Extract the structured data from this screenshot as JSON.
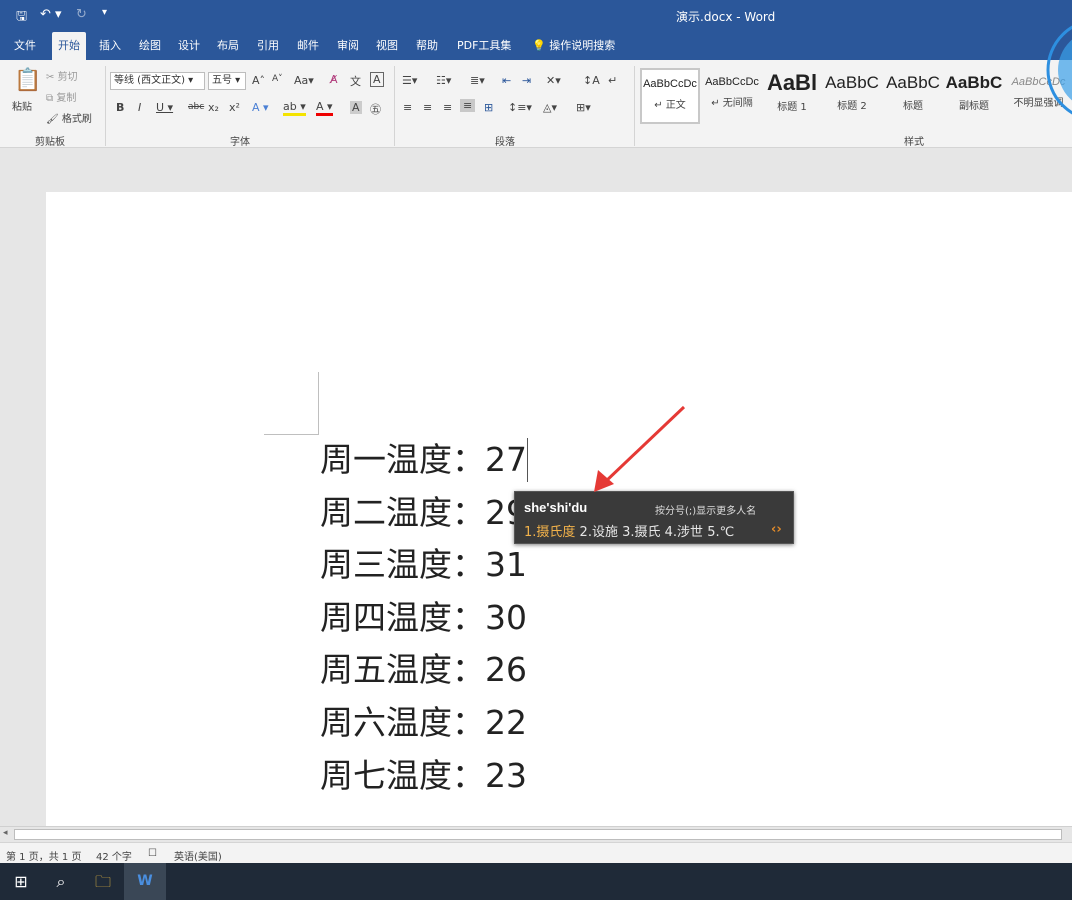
{
  "titlebar": {
    "title": "演示.docx  -  Word",
    "save_icon": "save-icon",
    "undo_icon": "undo-icon",
    "redo_icon": "redo-icon"
  },
  "menu": {
    "tabs": [
      "文件",
      "开始",
      "插入",
      "绘图",
      "设计",
      "布局",
      "引用",
      "邮件",
      "审阅",
      "视图",
      "帮助",
      "PDF工具集",
      "操作说明搜索"
    ],
    "active": "开始"
  },
  "ribbon": {
    "clipboard": {
      "paste": "粘贴",
      "cut": "剪切",
      "copy": "复制",
      "format_painter": "格式刷",
      "label": "剪贴板"
    },
    "font": {
      "family": "等线 (西文正文)",
      "size": "五号",
      "label": "字体"
    },
    "paragraph": {
      "label": "段落"
    },
    "styles": {
      "label": "样式",
      "items": [
        {
          "preview": "AaBbCcDc",
          "name": "↵ 正文"
        },
        {
          "preview": "AaBbCcDc",
          "name": "↵ 无间隔"
        },
        {
          "preview": "AaBl",
          "name": "标题 1"
        },
        {
          "preview": "AaBbC",
          "name": "标题 2"
        },
        {
          "preview": "AaBbC",
          "name": "标题"
        },
        {
          "preview": "AaBbC",
          "name": "副标题"
        },
        {
          "preview": "AaBbCcDc",
          "name": "不明显强调"
        }
      ]
    }
  },
  "document": {
    "lines": [
      "周一温度：27",
      "周二温度：29",
      "周三温度：31",
      "周四温度：30",
      "周五温度：26",
      "周六温度：22",
      "周七温度：23"
    ]
  },
  "ime": {
    "input": "she'shi'du",
    "hint": "按分号(;)显示更多人名",
    "candidates": [
      "1.摄氏度",
      "2.设施",
      "3.摄氏",
      "4.涉世",
      "5.℃"
    ]
  },
  "status": {
    "page": "第 1 页，共 1 页",
    "words": "42 个字",
    "language": "英语(美国)"
  },
  "colors": {
    "accent": "#2b579a",
    "annotation_arrow": "#e53935",
    "ime_highlight": "#f2b24a"
  }
}
